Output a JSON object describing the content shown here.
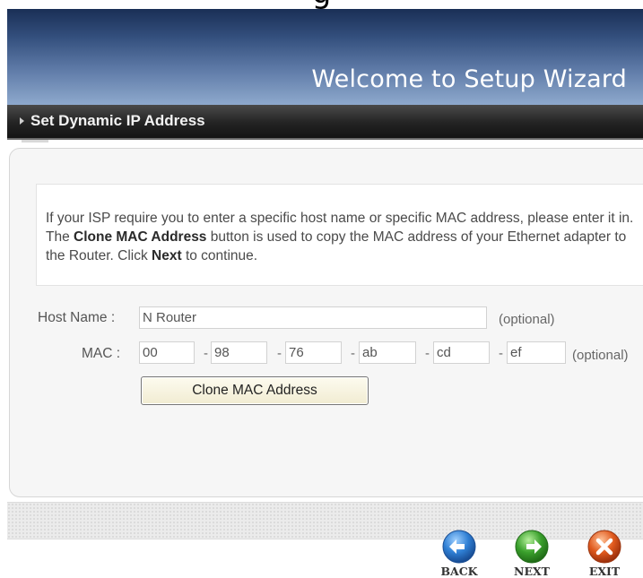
{
  "page_heading": "g",
  "banner": {
    "title": "Welcome to Setup Wizard"
  },
  "section": {
    "title": "Set Dynamic IP Address"
  },
  "info": {
    "part1": "If your ISP require you to enter a specific host name or specific MAC address, please enter it in. The ",
    "bold1": "Clone MAC Address",
    "part2": " button is used to copy the MAC address of your Ethernet adapter to the Router. Click ",
    "bold2": "Next",
    "part3": " to continue."
  },
  "form": {
    "host_label": "Host Name :",
    "host_value": "N Router",
    "host_optional": "(optional)",
    "mac_label": "MAC :",
    "mac_octets": [
      "00",
      "98",
      "76",
      "ab",
      "cd",
      "ef"
    ],
    "mac_separator": "-",
    "mac_optional": "(optional)",
    "clone_button": "Clone MAC Address"
  },
  "nav": {
    "back": {
      "label": "BACK",
      "icon": "back-arrow-icon",
      "color": "#2f7fd4"
    },
    "next": {
      "label": "NEXT",
      "icon": "next-arrow-icon",
      "color": "#3aa02c"
    },
    "exit": {
      "label": "EXIT",
      "icon": "exit-x-icon",
      "color": "#e05a1e"
    }
  }
}
